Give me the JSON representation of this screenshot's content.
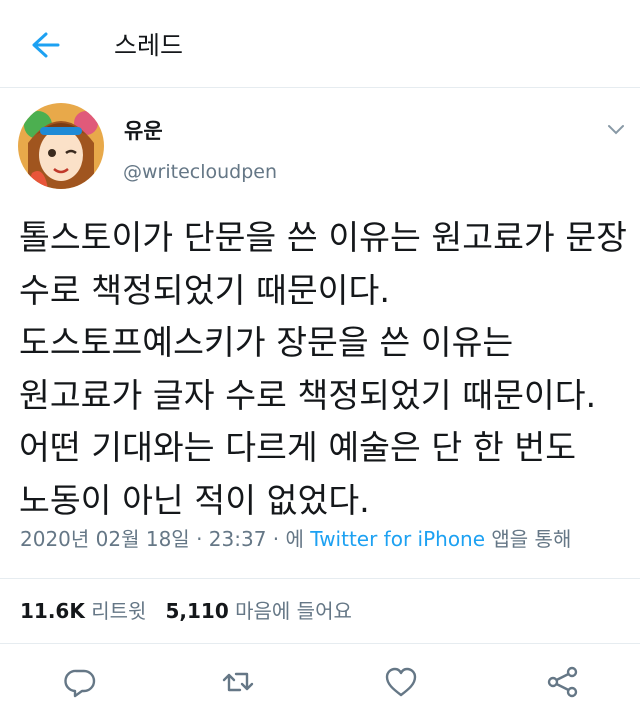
{
  "header": {
    "title": "스레드",
    "back_icon": "arrow-left-icon",
    "accent": "#1da1f2"
  },
  "author": {
    "name": "유운",
    "handle": "@writecloudpen"
  },
  "tweet": {
    "lines": [
      "톨스토이가 단문을 쓴 이유는 원고료가 문장",
      "수로 책정되었기 때문이다.",
      "도스토프예스키가 장문을 쓴 이유는",
      "원고료가 글자 수로 책정되었기 때문이다.",
      "어떤 기대와는 다르게 예술은 단 한 번도",
      "노동이 아닌 적이 없었다."
    ]
  },
  "meta": {
    "date": "2020년 02월 18일",
    "sep1": " · ",
    "time": "23:37",
    "sep2": " · 에 ",
    "source": "Twitter for iPhone",
    "suffix": " 앱을 통해"
  },
  "stats": {
    "retweets_count": "11.6K",
    "retweets_label": "리트윗",
    "likes_count": "5,110",
    "likes_label": "마음에 들어요"
  },
  "actions": [
    "reply-icon",
    "retweet-icon",
    "like-icon",
    "share-icon"
  ],
  "colors": {
    "secondary_text": "#657786",
    "divider": "#e6ecf0"
  }
}
